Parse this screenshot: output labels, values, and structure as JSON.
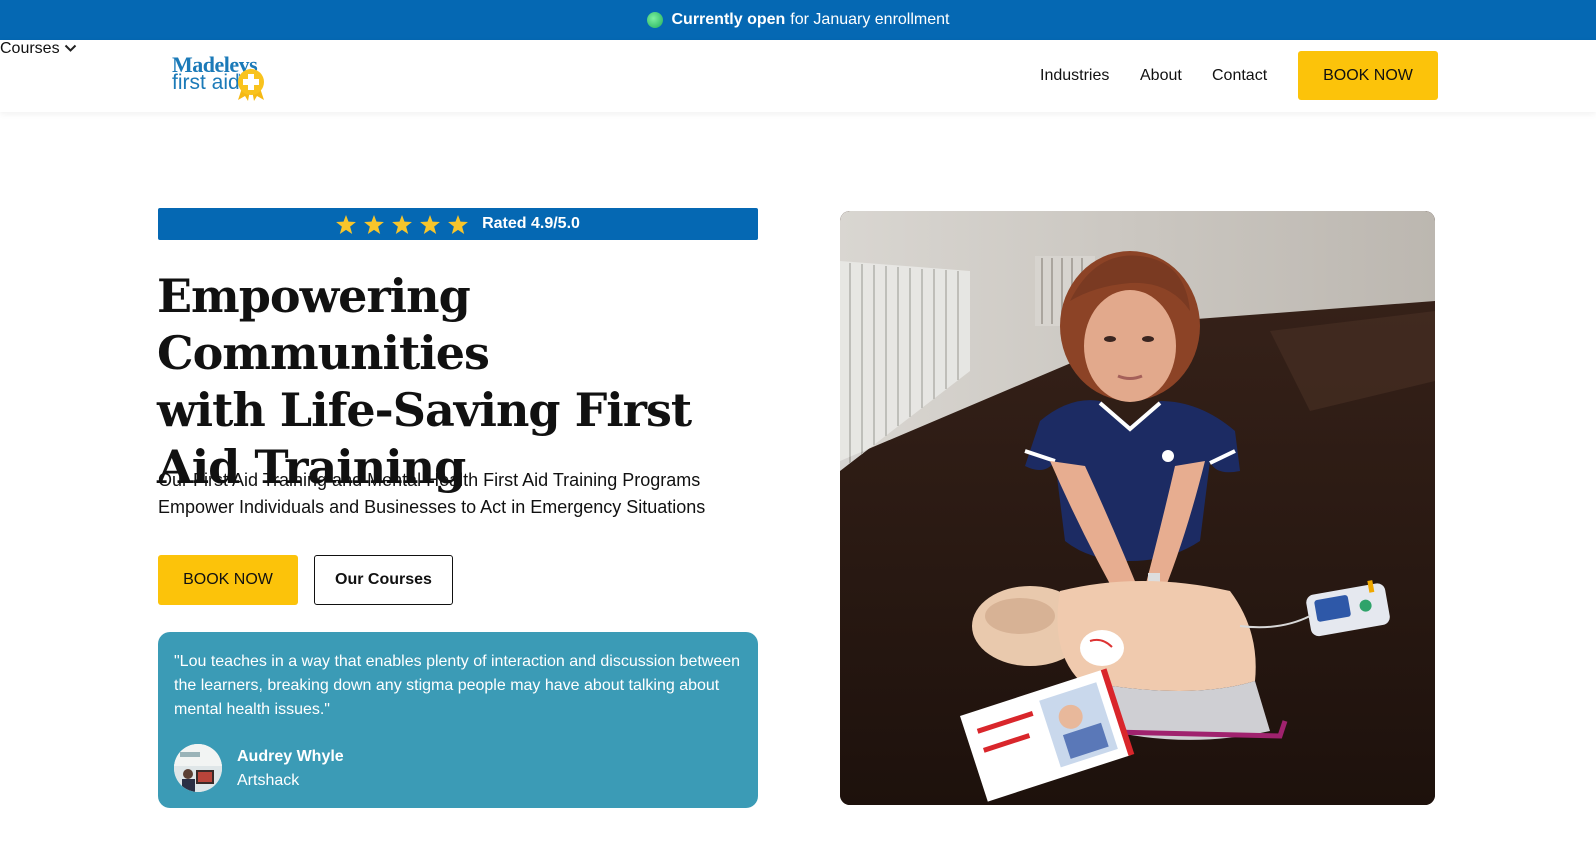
{
  "banner": {
    "status_bold": "Currently open",
    "status_rest": "for January enrollment"
  },
  "logo": {
    "line1": "Madeleys",
    "line2": "first aid"
  },
  "nav": {
    "items": [
      "Courses",
      "Industries",
      "About",
      "Contact"
    ],
    "book_label": "BOOK NOW"
  },
  "hero": {
    "rating_text": "Rated 4.9/5.0",
    "rating_stars": 5,
    "headline_lines": [
      "Empowering Communities",
      "with Life-Saving First",
      "Aid Training"
    ],
    "subtitle_line1": "Our First Aid Training and Mental Health First Aid Training Programs",
    "subtitle_line2": "Empower Individuals and Businesses to Act in Emergency Situations",
    "book_label": "BOOK NOW",
    "courses_label": "Our Courses"
  },
  "testimonial": {
    "quote": "\"Lou teaches in a way that enables plenty of interaction and discussion between the learners, breaking down any stigma people may have about talking about mental health issues.\"",
    "name": "Audrey Whyle",
    "company": "Artshack"
  },
  "colors": {
    "brand_blue": "#0568b3",
    "accent_yellow": "#fcc30a",
    "testimonial_teal": "#3b9bb6",
    "star_gold": "#f7c52b"
  }
}
